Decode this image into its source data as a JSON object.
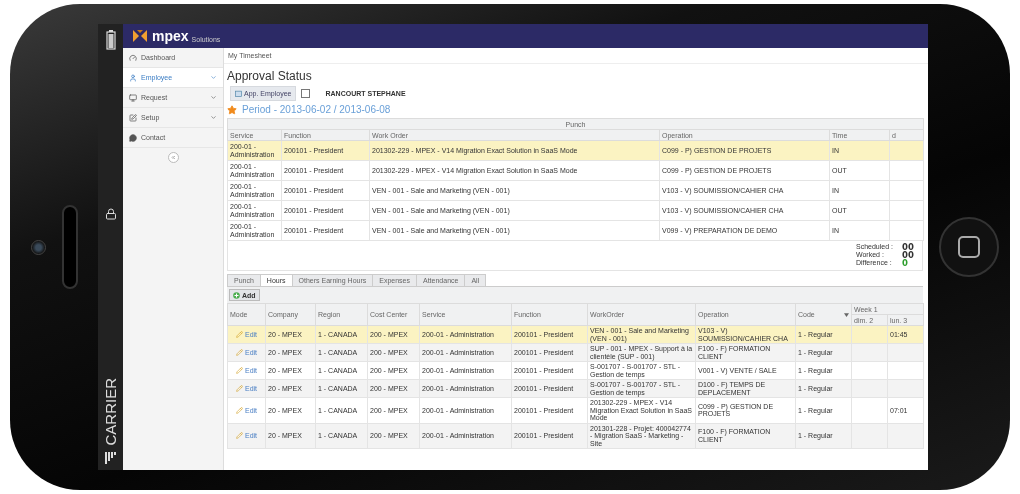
{
  "status_bar": {
    "carrier": "CARRIER"
  },
  "app": {
    "logo": "mpex",
    "logo_sub": "Solutions"
  },
  "sidebar": {
    "items": [
      {
        "label": "Dashboard",
        "selected": false,
        "expandable": false
      },
      {
        "label": "Employee",
        "selected": true,
        "expandable": true
      },
      {
        "label": "Request",
        "selected": false,
        "expandable": true
      },
      {
        "label": "Setup",
        "selected": false,
        "expandable": true
      },
      {
        "label": "Contact",
        "selected": false,
        "expandable": false
      }
    ]
  },
  "breadcrumb": "My Timesheet",
  "title": "Approval Status",
  "approve_button": "App. Employee",
  "approve_checkbox": {
    "checked": false
  },
  "employee_name": "RANCOURT STEPHANE",
  "period": "Period - 2013-06-02 / 2013-06-08",
  "punch_table": {
    "group": "Punch",
    "columns": [
      "Service",
      "Function",
      "Work Order",
      "Operation",
      "Time",
      "d"
    ],
    "rows": [
      {
        "selected": true,
        "cells": [
          "200-01 - Administration",
          "200101 - President",
          "201302-229 - MPEX - V14 Migration Exact Solution in SaaS Mode",
          "C099 - P) GESTION DE PROJETS",
          "IN"
        ]
      },
      {
        "selected": false,
        "cells": [
          "200-01 - Administration",
          "200101 - President",
          "201302-229 - MPEX - V14 Migration Exact Solution in SaaS Mode",
          "C099 - P) GESTION DE PROJETS",
          "OUT"
        ]
      },
      {
        "selected": false,
        "cells": [
          "200-01 - Administration",
          "200101 - President",
          "VEN - 001 - Sale and Marketing (VEN - 001)",
          "V103 - V) SOUMISSION/CAHIER CHA",
          "IN"
        ]
      },
      {
        "selected": false,
        "cells": [
          "200-01 - Administration",
          "200101 - President",
          "VEN - 001 - Sale and Marketing (VEN - 001)",
          "V103 - V) SOUMISSION/CAHIER CHA",
          "OUT"
        ]
      },
      {
        "selected": false,
        "cells": [
          "200-01 - Administration",
          "200101 - President",
          "VEN - 001 - Sale and Marketing (VEN - 001)",
          "V099 - V) PREPARATION DE DEMO",
          "IN"
        ]
      }
    ]
  },
  "summary": [
    {
      "label": "Scheduled :",
      "value": "00",
      "color": "#333333"
    },
    {
      "label": "Worked :",
      "value": "00",
      "color": "#333333"
    },
    {
      "label": "Difference :",
      "value": "0",
      "color": "#2e9e2e"
    }
  ],
  "tabs": [
    {
      "label": "Punch",
      "selected": false
    },
    {
      "label": "Hours",
      "selected": true
    },
    {
      "label": "Others Earning Hours",
      "selected": false
    },
    {
      "label": "Expenses",
      "selected": false
    },
    {
      "label": "Attendance",
      "selected": false
    },
    {
      "label": "All",
      "selected": false
    }
  ],
  "add_button": "Add",
  "hours_table": {
    "columns": [
      "Mode",
      "Company",
      "Region",
      "Cost Center",
      "Service",
      "Function",
      "WorkOrder",
      "Operation",
      "Code"
    ],
    "week_group": "Week 1",
    "days": [
      "dim. 2",
      "lun. 3"
    ],
    "rows": [
      {
        "selected": true,
        "cells": [
          "Edit",
          "20 - MPEX",
          "1 - CANADA",
          "200 - MPEX",
          "200-01 - Administration",
          "200101 - President",
          "VEN - 001 - Sale and Marketing (VEN - 001)",
          "V103 - V) SOUMISSION/CAHIER CHA",
          "1 - Regular",
          "",
          "01:45"
        ]
      },
      {
        "selected": false,
        "cells": [
          "Edit",
          "20 - MPEX",
          "1 - CANADA",
          "200 - MPEX",
          "200-01 - Administration",
          "200101 - President",
          "SUP - 001 - MPEX - Support à la clientèle (SUP - 001)",
          "F100 - F) FORMATION CLIENT",
          "1 - Regular"
        ]
      },
      {
        "selected": false,
        "cells": [
          "Edit",
          "20 - MPEX",
          "1 - CANADA",
          "200 - MPEX",
          "200-01 - Administration",
          "200101 - President",
          "S-001707 - S-001707 - STL - Gestion de temps",
          "V001 - V) VENTE / SALE",
          "1 - Regular"
        ]
      },
      {
        "selected": false,
        "cells": [
          "Edit",
          "20 - MPEX",
          "1 - CANADA",
          "200 - MPEX",
          "200-01 - Administration",
          "200101 - President",
          "S-001707 - S-001707 - STL - Gestion de temps",
          "D100 - F) TEMPS DE DEPLACEMENT",
          "1 - Regular"
        ]
      },
      {
        "selected": false,
        "cells": [
          "Edit",
          "20 - MPEX",
          "1 - CANADA",
          "200 - MPEX",
          "200-01 - Administration",
          "200101 - President",
          "201302-229 - MPEX - V14 Migration Exact Solution in SaaS Mode",
          "C099 - P) GESTION DE PROJETS",
          "1 - Regular",
          "",
          "07:01"
        ]
      },
      {
        "selected": false,
        "cells": [
          "Edit",
          "20 - MPEX",
          "1 - CANADA",
          "200 - MPEX",
          "200-01 - Administration",
          "200101 - President",
          "201301-228 - Projet: 400042774 - Migration SaaS - Marketing - Site",
          "F100 - F) FORMATION CLIENT",
          "1 - Regular"
        ]
      }
    ]
  }
}
